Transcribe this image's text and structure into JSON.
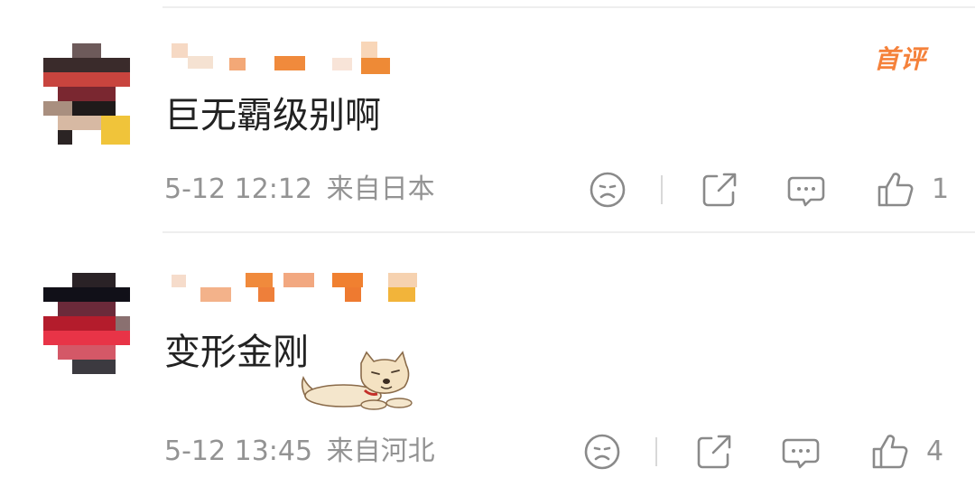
{
  "comments": [
    {
      "text": "巨无霸级别啊",
      "timestamp": "5-12 12:12",
      "location": "来自日本",
      "badge": "首评",
      "likes": "1",
      "avatar_colors": [
        "#3a2b2b",
        "#c8443e",
        "#7a2730",
        "#e9c74a",
        "#a98f7f",
        "#1f1a1a",
        "#d7b9a3",
        "#f0c43a"
      ]
    },
    {
      "text": "变形金刚",
      "timestamp": "5-12 13:45",
      "location": "来自河北",
      "badge": "",
      "likes": "4",
      "sticker": "dog-sticker",
      "avatar_colors": [
        "#2a2226",
        "#b41c2c",
        "#e83447",
        "#6b2a3a",
        "#111018",
        "#d45867",
        "#8a7070",
        "#3c3a40"
      ]
    }
  ],
  "actions": {
    "dislike_icon": "sad-face-icon",
    "share_icon": "share-icon",
    "comment_icon": "comment-bubble-icon",
    "like_icon": "thumbs-up-icon"
  },
  "colors": {
    "badge": "#f5813a",
    "meta_text": "#939393",
    "comment_text": "#222222",
    "username_blur": "#f08a3c"
  }
}
